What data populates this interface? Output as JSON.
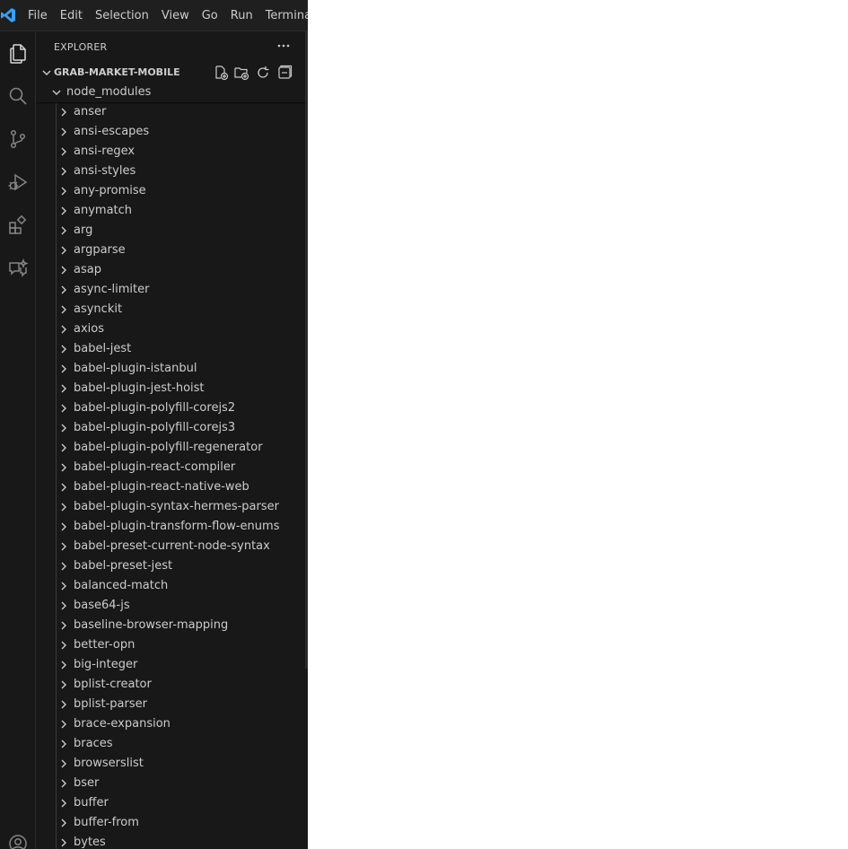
{
  "menu": [
    "File",
    "Edit",
    "Selection",
    "View",
    "Go",
    "Run",
    "Terminal"
  ],
  "activity_bar": [
    "files-icon",
    "search-icon",
    "source-control-icon",
    "run-debug-icon",
    "extensions-icon",
    "chat-icon",
    "account-icon"
  ],
  "sidebar": {
    "title": "EXPLORER",
    "section_title": "GRAB-MARKET-MOBILE",
    "section_actions": [
      "new-file-icon",
      "new-folder-icon",
      "refresh-icon",
      "collapse-all-icon"
    ],
    "open_folder": "node_modules",
    "items": [
      "anser",
      "ansi-escapes",
      "ansi-regex",
      "ansi-styles",
      "any-promise",
      "anymatch",
      "arg",
      "argparse",
      "asap",
      "async-limiter",
      "asynckit",
      "axios",
      "babel-jest",
      "babel-plugin-istanbul",
      "babel-plugin-jest-hoist",
      "babel-plugin-polyfill-corejs2",
      "babel-plugin-polyfill-corejs3",
      "babel-plugin-polyfill-regenerator",
      "babel-plugin-react-compiler",
      "babel-plugin-react-native-web",
      "babel-plugin-syntax-hermes-parser",
      "babel-plugin-transform-flow-enums",
      "babel-preset-current-node-syntax",
      "babel-preset-jest",
      "balanced-match",
      "base64-js",
      "baseline-browser-mapping",
      "better-opn",
      "big-integer",
      "bplist-creator",
      "bplist-parser",
      "brace-expansion",
      "braces",
      "browserslist",
      "bser",
      "buffer",
      "buffer-from",
      "bytes"
    ]
  },
  "colors": {
    "background": "#181818",
    "text": "#cccccc",
    "logo": "#3aa0f3"
  }
}
